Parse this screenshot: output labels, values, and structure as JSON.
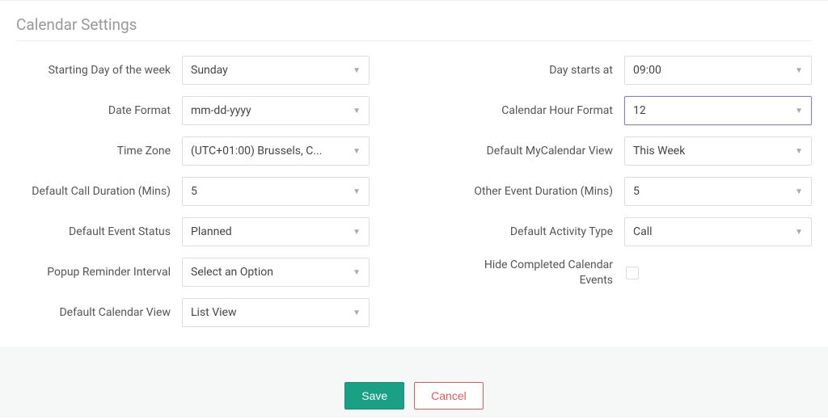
{
  "title": "Calendar Settings",
  "left": {
    "starting_day": {
      "label": "Starting Day of the week",
      "value": "Sunday"
    },
    "date_format": {
      "label": "Date Format",
      "value": "mm-dd-yyyy"
    },
    "time_zone": {
      "label": "Time Zone",
      "value": "(UTC+01:00) Brussels, C..."
    },
    "call_duration": {
      "label": "Default Call Duration (Mins)",
      "value": "5"
    },
    "event_status": {
      "label": "Default Event Status",
      "value": "Planned"
    },
    "popup_reminder": {
      "label": "Popup Reminder Interval",
      "value": "Select an Option"
    },
    "calendar_view": {
      "label": "Default Calendar View",
      "value": "List View"
    }
  },
  "right": {
    "day_starts": {
      "label": "Day starts at",
      "value": "09:00"
    },
    "hour_format": {
      "label": "Calendar Hour Format",
      "value": "12"
    },
    "mycal_view": {
      "label": "Default MyCalendar View",
      "value": "This Week"
    },
    "other_duration": {
      "label": "Other Event Duration (Mins)",
      "value": "5"
    },
    "activity_type": {
      "label": "Default Activity Type",
      "value": "Call"
    },
    "hide_completed": {
      "label": "Hide Completed Calendar Events",
      "checked": false
    }
  },
  "buttons": {
    "save": "Save",
    "cancel": "Cancel"
  }
}
